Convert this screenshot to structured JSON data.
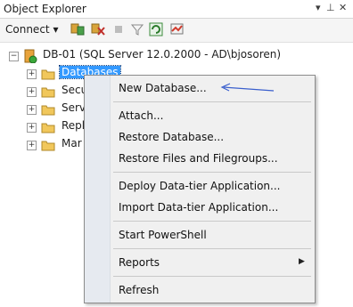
{
  "title_bar": {
    "title": "Object Explorer",
    "pin_icon": "pin-icon",
    "close_icon": "close-icon"
  },
  "toolbar": {
    "connect_label": "Connect",
    "icons": [
      "connect-object-icon",
      "disconnect-icon",
      "stop-icon",
      "filter-icon",
      "refresh-icon",
      "activity-monitor-icon"
    ]
  },
  "tree": {
    "server": "DB-01 (SQL Server 12.0.2000 - AD\\bjosoren)",
    "nodes": [
      "Databases",
      "Secu",
      "Serv",
      "Repl",
      "Mar"
    ]
  },
  "context_menu": {
    "items": [
      "New Database...",
      "Attach...",
      "Restore Database...",
      "Restore Files and Filegroups...",
      "Deploy Data-tier Application...",
      "Import Data-tier Application...",
      "Start PowerShell",
      "Reports",
      "Refresh"
    ]
  },
  "colors": {
    "selection": "#3399ff",
    "arrow": "#3a5fcd",
    "menu_bg": "#f0f0f0"
  }
}
